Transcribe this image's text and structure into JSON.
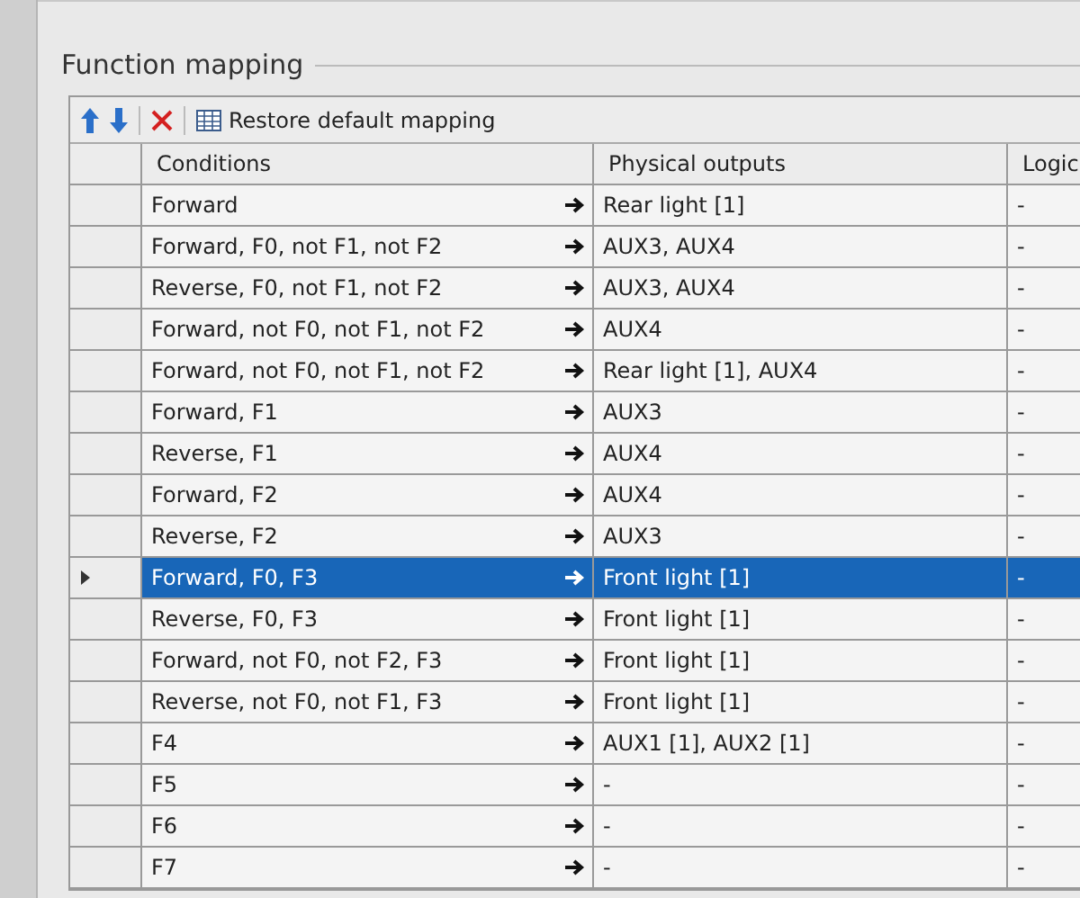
{
  "group_title": "Function mapping",
  "toolbar": {
    "restore_label": "Restore default mapping"
  },
  "table": {
    "columns": [
      "Conditions",
      "Physical outputs",
      "Logic"
    ],
    "rows": [
      {
        "conditions": "Forward",
        "outputs": "Rear light [1]",
        "logic": "-",
        "selected": false
      },
      {
        "conditions": "Forward, F0, not F1, not F2",
        "outputs": "AUX3, AUX4",
        "logic": "-",
        "selected": false
      },
      {
        "conditions": "Reverse, F0, not F1, not F2",
        "outputs": "AUX3, AUX4",
        "logic": "-",
        "selected": false
      },
      {
        "conditions": "Forward, not F0, not F1, not F2",
        "outputs": "AUX4",
        "logic": "-",
        "selected": false
      },
      {
        "conditions": "Forward, not F0, not F1, not F2",
        "outputs": "Rear light [1], AUX4",
        "logic": "-",
        "selected": false
      },
      {
        "conditions": "Forward, F1",
        "outputs": "AUX3",
        "logic": "-",
        "selected": false
      },
      {
        "conditions": "Reverse, F1",
        "outputs": "AUX4",
        "logic": "-",
        "selected": false
      },
      {
        "conditions": "Forward, F2",
        "outputs": "AUX4",
        "logic": "-",
        "selected": false
      },
      {
        "conditions": "Reverse, F2",
        "outputs": "AUX3",
        "logic": "-",
        "selected": false
      },
      {
        "conditions": "Forward, F0, F3",
        "outputs": "Front light [1]",
        "logic": "-",
        "selected": true
      },
      {
        "conditions": "Reverse, F0, F3",
        "outputs": "Front light [1]",
        "logic": "-",
        "selected": false
      },
      {
        "conditions": "Forward, not F0, not F2, F3",
        "outputs": "Front light [1]",
        "logic": "-",
        "selected": false
      },
      {
        "conditions": "Reverse, not F0, not F1, F3",
        "outputs": "Front light [1]",
        "logic": "-",
        "selected": false
      },
      {
        "conditions": "F4",
        "outputs": "AUX1 [1], AUX2 [1]",
        "logic": "-",
        "selected": false
      },
      {
        "conditions": "F5",
        "outputs": "-",
        "logic": "-",
        "selected": false
      },
      {
        "conditions": "F6",
        "outputs": "-",
        "logic": "-",
        "selected": false
      },
      {
        "conditions": "F7",
        "outputs": "-",
        "logic": "-",
        "selected": false
      }
    ]
  }
}
